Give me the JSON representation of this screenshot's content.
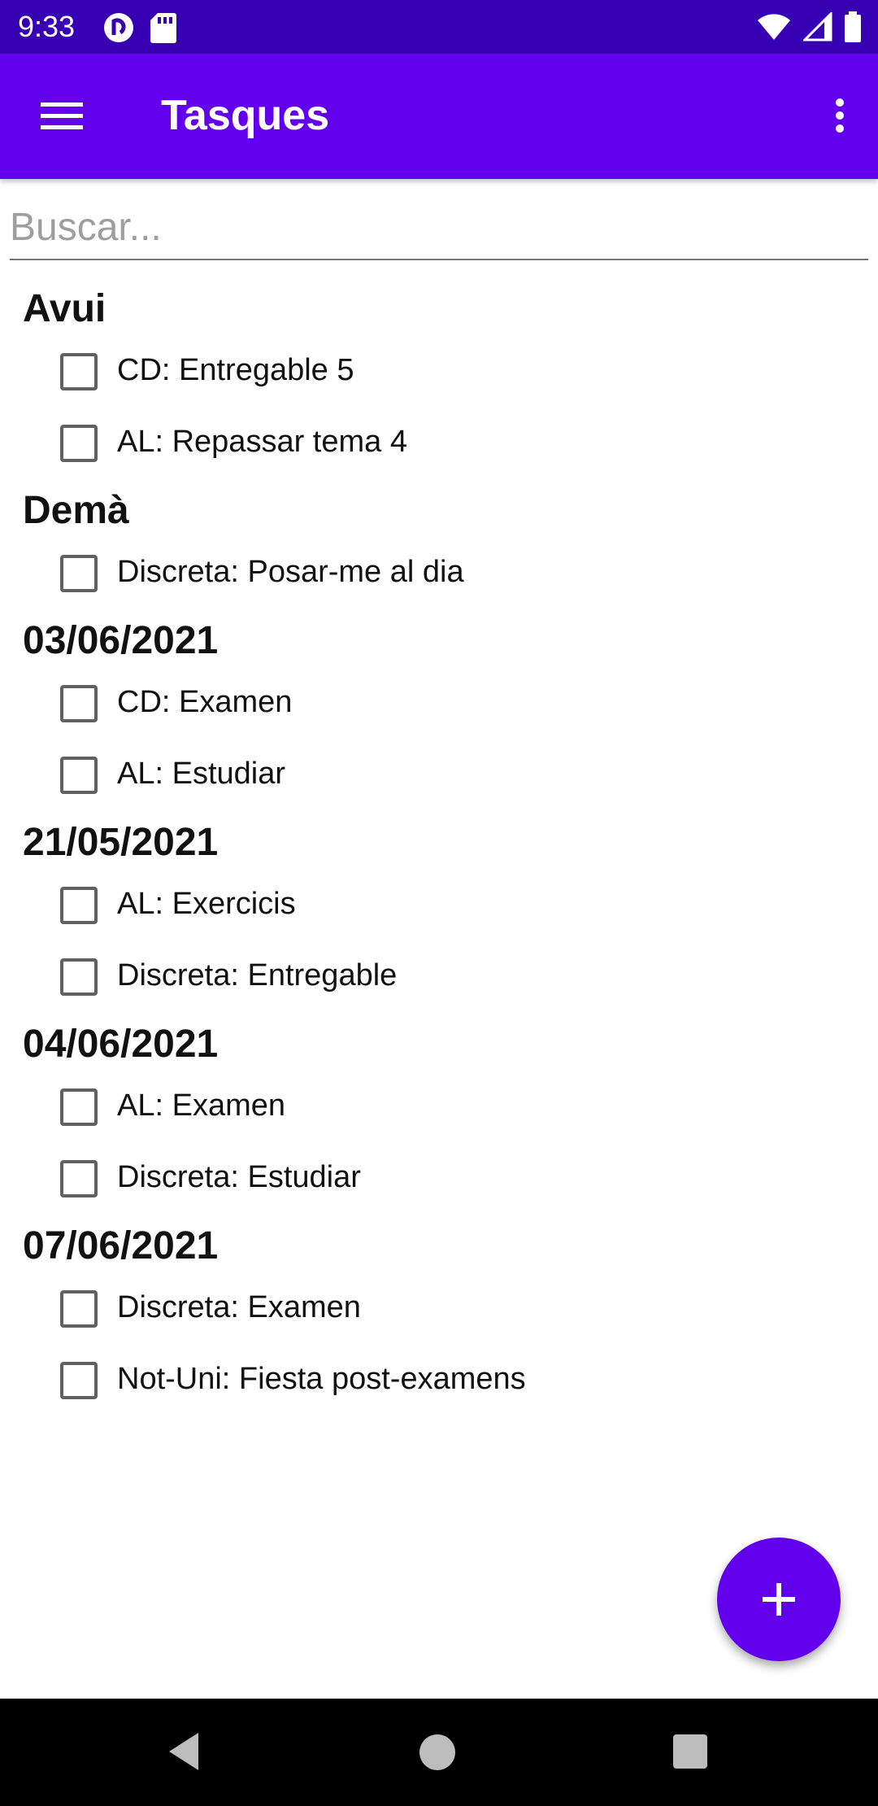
{
  "status_bar": {
    "time": "9:33",
    "left_icons": [
      "pocket-casts-icon",
      "sd-card-icon"
    ],
    "right_icons": [
      "wifi-icon",
      "signal-icon",
      "battery-icon"
    ]
  },
  "app_bar": {
    "title": "Tasques",
    "nav_icon": "menu-icon",
    "overflow_icon": "more-vert-icon",
    "color": "#6200ee"
  },
  "search": {
    "placeholder": "Buscar...",
    "value": ""
  },
  "groups": [
    {
      "title": "Avui",
      "tasks": [
        {
          "label": "CD: Entregable 5",
          "checked": false
        },
        {
          "label": "AL: Repassar tema 4",
          "checked": false
        }
      ]
    },
    {
      "title": "Demà",
      "tasks": [
        {
          "label": "Discreta: Posar-me al dia",
          "checked": false
        }
      ]
    },
    {
      "title": "03/06/2021",
      "tasks": [
        {
          "label": "CD: Examen",
          "checked": false
        },
        {
          "label": "AL: Estudiar",
          "checked": false
        }
      ]
    },
    {
      "title": "21/05/2021",
      "tasks": [
        {
          "label": "AL: Exercicis",
          "checked": false
        },
        {
          "label": "Discreta: Entregable",
          "checked": false
        }
      ]
    },
    {
      "title": "04/06/2021",
      "tasks": [
        {
          "label": "AL: Examen",
          "checked": false
        },
        {
          "label": "Discreta: Estudiar",
          "checked": false
        }
      ]
    },
    {
      "title": "07/06/2021",
      "tasks": [
        {
          "label": "Discreta: Examen",
          "checked": false
        },
        {
          "label": "Not-Uni: Fiesta post-examens",
          "checked": false
        }
      ]
    }
  ],
  "fab": {
    "icon": "add-icon",
    "color": "#6200ee"
  },
  "nav_bar": {
    "icons": [
      "back-icon",
      "home-icon",
      "recents-icon"
    ]
  },
  "colors": {
    "status_bar": "#3700b3",
    "primary": "#6200ee"
  }
}
